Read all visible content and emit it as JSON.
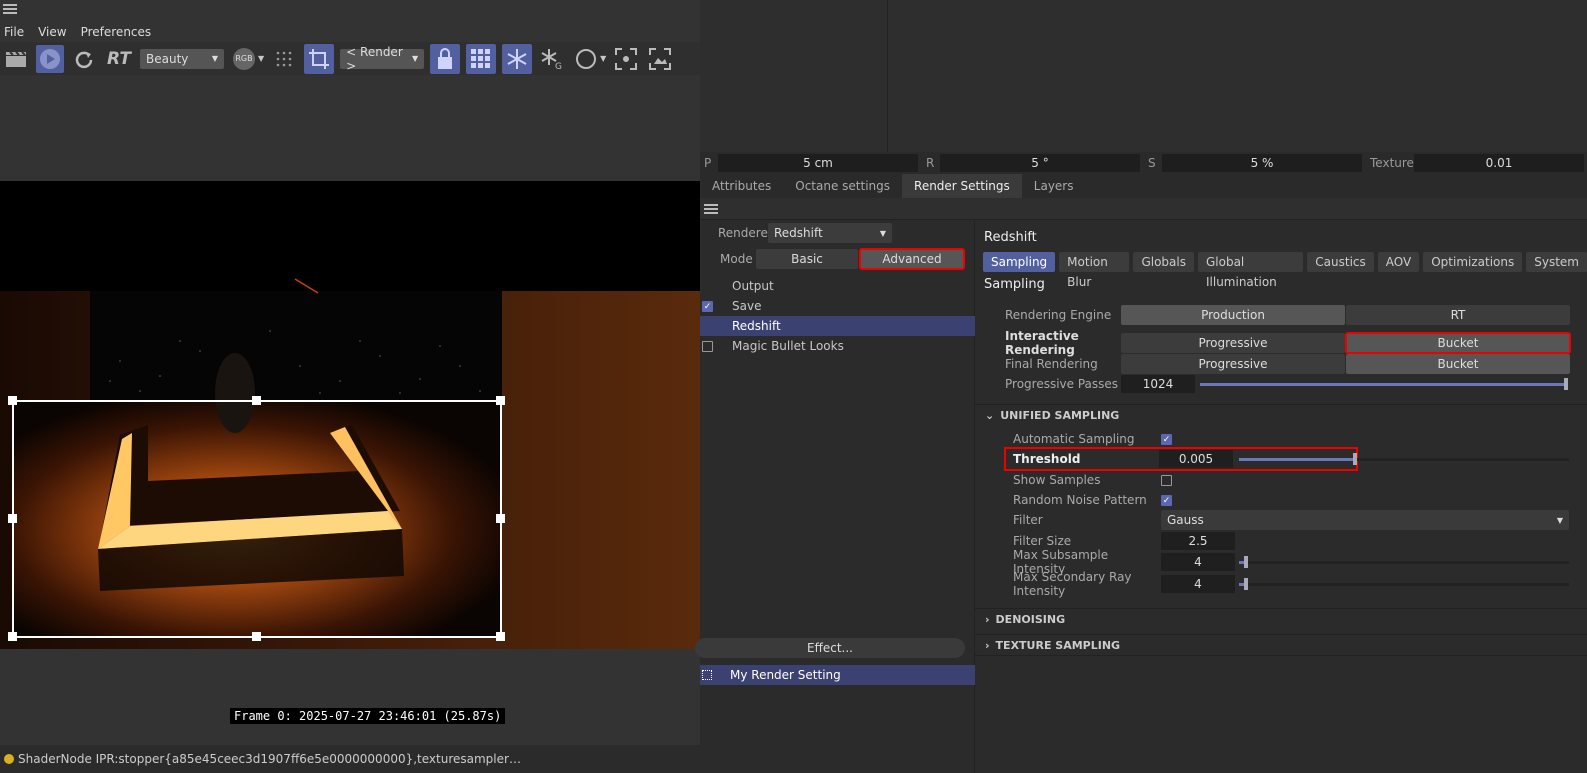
{
  "menu": {
    "file": "File",
    "view": "View",
    "preferences": "Preferences"
  },
  "toolbar": {
    "rt_label": "RT",
    "pass_select": "Beauty",
    "rgb_label": "RGB",
    "render_select": "< Render >",
    "g_label": "G"
  },
  "viewer": {
    "frame_info": "Frame  0:  2025-07-27  23:46:01  (25.87s)"
  },
  "status": {
    "text": "ShaderNode IPR:stopper{a85e45ceec3d1907ff6e5e0000000000},texturesampler…"
  },
  "coords": {
    "p_label": "P",
    "p_value": "5 cm",
    "r_label": "R",
    "r_value": "5 °",
    "s_label": "S",
    "s_value": "5 %",
    "texture_label": "Texture",
    "texture_value": "0.01"
  },
  "tabs": [
    "Attributes",
    "Octane settings",
    "Render Settings",
    "Layers"
  ],
  "render_settings": {
    "renderer_label": "Renderer",
    "renderer_value": "Redshift",
    "mode_label": "Mode",
    "mode_basic": "Basic",
    "mode_advanced": "Advanced",
    "list": [
      "Output",
      "Save",
      "Redshift",
      "Magic Bullet Looks"
    ],
    "effect_button": "Effect...",
    "setting_name": "My Render Setting"
  },
  "redshift": {
    "title": "Redshift",
    "tabs": [
      "Sampling",
      "Motion Blur",
      "Globals",
      "Global Illumination",
      "Caustics",
      "AOV",
      "Optimizations",
      "System"
    ],
    "section_title": "Sampling",
    "rendering_engine_label": "Rendering Engine",
    "engine_production": "Production",
    "engine_rt": "RT",
    "interactive_label": "Interactive Rendering",
    "final_label": "Final Rendering",
    "progressive": "Progressive",
    "bucket": "Bucket",
    "passes_label": "Progressive Passes",
    "passes_value": "1024",
    "passes_fraction": 1.0,
    "unified_title": "UNIFIED SAMPLING",
    "auto_sampling_label": "Automatic Sampling",
    "threshold_label": "Threshold",
    "threshold_value": "0.005",
    "threshold_fraction": 0.35,
    "show_samples_label": "Show Samples",
    "random_noise_label": "Random Noise Pattern",
    "filter_label": "Filter",
    "filter_value": "Gauss",
    "filter_size_label": "Filter Size",
    "filter_size_value": "2.5",
    "max_subsample_label": "Max Subsample Intensity",
    "max_subsample_value": "4",
    "max_subsample_fraction": 0.02,
    "max_secondary_label": "Max Secondary Ray Intensity",
    "max_secondary_value": "4",
    "max_secondary_fraction": 0.02,
    "denoising_title": "DENOISING",
    "texture_sampling_title": "TEXTURE SAMPLING"
  },
  "colors": {
    "accent": "#5360a0",
    "highlight_red": "#e00000",
    "render_glow": "#ffb040"
  }
}
